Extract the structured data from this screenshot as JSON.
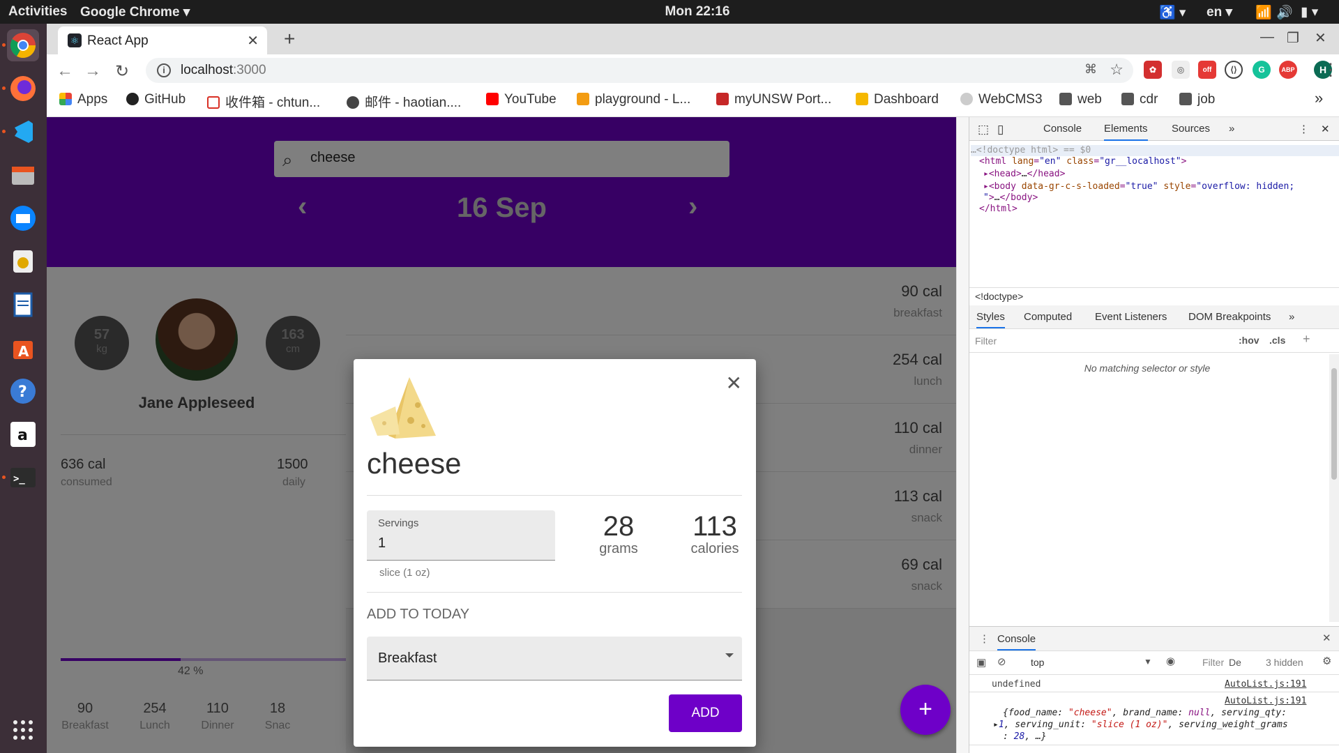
{
  "system": {
    "activities": "Activities",
    "app_name": "Google Chrome ▾",
    "clock": "Mon 22:16",
    "lang": "en ▾"
  },
  "browser": {
    "tab_title": "React App",
    "url_host": "localhost",
    "url_port": ":3000",
    "bookmarks": [
      "Apps",
      "GitHub",
      "收件箱 - chtun...",
      "邮件 - haotian....",
      "YouTube",
      "playground - L...",
      "myUNSW Port...",
      "Dashboard",
      "WebCMS3",
      "web",
      "cdr",
      "job"
    ]
  },
  "app": {
    "search_query": "cheese",
    "date": "16 Sep",
    "profile": {
      "weight": "57",
      "weight_unit": "kg",
      "height": "163",
      "height_unit": "cm",
      "name": "Jane Appleseed"
    },
    "consumed": "636 cal",
    "consumed_label": "consumed",
    "daily": "1500",
    "daily_label": "daily",
    "progress_percent": 42,
    "progress_text": "42 %",
    "meals": [
      {
        "value": "90",
        "label": "Breakfast"
      },
      {
        "value": "254",
        "label": "Lunch"
      },
      {
        "value": "110",
        "label": "Dinner"
      },
      {
        "value": "18",
        "label": "Snac"
      }
    ],
    "entries": [
      {
        "cal": "90 cal",
        "meal": "breakfast"
      },
      {
        "cal": "254 cal",
        "meal": "lunch"
      },
      {
        "cal": "110 cal",
        "meal": "dinner"
      },
      {
        "cal": "113 cal",
        "meal": "snack"
      },
      {
        "cal": "69 cal",
        "meal": "snack"
      }
    ],
    "fab": "+"
  },
  "dialog": {
    "food_name": "cheese",
    "servings_label": "Servings",
    "servings_value": "1",
    "serving_unit": "slice (1 oz)",
    "grams": "28",
    "grams_label": "grams",
    "calories": "113",
    "calories_label": "calories",
    "add_to_today": "ADD TO TODAY",
    "meal_selected": "Breakfast",
    "add_button": "ADD"
  },
  "devtools": {
    "tabs": [
      "Console",
      "Elements",
      "Sources"
    ],
    "doctype_line": "<!doctype html>",
    "doctype_eq": " == $0",
    "breadcrumb": "<!doctype>",
    "style_tabs": [
      "Styles",
      "Computed",
      "Event Listeners",
      "DOM Breakpoints"
    ],
    "filter_placeholder": "Filter",
    "hov": ":hov",
    "cls": ".cls",
    "no_match": "No matching selector or style",
    "console_title": "Console",
    "context": "top",
    "console_filter": "Filter",
    "default_levels": "De",
    "hidden": "3 hidden",
    "log_undefined": "undefined",
    "source": "AutoList.js:191"
  }
}
